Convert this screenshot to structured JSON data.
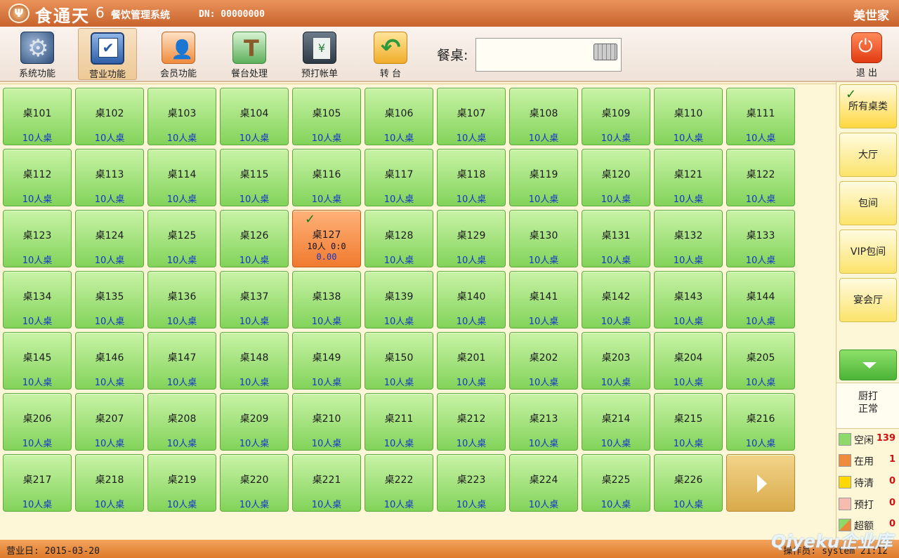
{
  "title_bar": {
    "brand": "食通天",
    "version": "6",
    "system_name": "餐饮管理系统",
    "dn": "DN: 00000000",
    "vendor": "美世家"
  },
  "toolbar": {
    "buttons": [
      {
        "label": "系统功能",
        "icon": "gear-icon"
      },
      {
        "label": "营业功能",
        "icon": "checkbox-icon",
        "active": true
      },
      {
        "label": "会员功能",
        "icon": "member-icon"
      },
      {
        "label": "餐台处理",
        "icon": "dining-table-icon"
      },
      {
        "label": "预打帐单",
        "icon": "bill-icon"
      },
      {
        "label": "转 台",
        "icon": "transfer-icon"
      }
    ],
    "table_label": "餐桌:",
    "table_input_value": "",
    "exit_label": "退 出"
  },
  "tables": [
    {
      "name": "桌101",
      "sub": "10人桌"
    },
    {
      "name": "桌102",
      "sub": "10人桌"
    },
    {
      "name": "桌103",
      "sub": "10人桌"
    },
    {
      "name": "桌104",
      "sub": "10人桌"
    },
    {
      "name": "桌105",
      "sub": "10人桌"
    },
    {
      "name": "桌106",
      "sub": "10人桌"
    },
    {
      "name": "桌107",
      "sub": "10人桌"
    },
    {
      "name": "桌108",
      "sub": "10人桌"
    },
    {
      "name": "桌109",
      "sub": "10人桌"
    },
    {
      "name": "桌110",
      "sub": "10人桌"
    },
    {
      "name": "桌111",
      "sub": "10人桌"
    },
    {
      "name": "桌112",
      "sub": "10人桌"
    },
    {
      "name": "桌113",
      "sub": "10人桌"
    },
    {
      "name": "桌114",
      "sub": "10人桌"
    },
    {
      "name": "桌115",
      "sub": "10人桌"
    },
    {
      "name": "桌116",
      "sub": "10人桌"
    },
    {
      "name": "桌117",
      "sub": "10人桌"
    },
    {
      "name": "桌118",
      "sub": "10人桌"
    },
    {
      "name": "桌119",
      "sub": "10人桌"
    },
    {
      "name": "桌120",
      "sub": "10人桌"
    },
    {
      "name": "桌121",
      "sub": "10人桌"
    },
    {
      "name": "桌122",
      "sub": "10人桌"
    },
    {
      "name": "桌123",
      "sub": "10人桌"
    },
    {
      "name": "桌124",
      "sub": "10人桌"
    },
    {
      "name": "桌125",
      "sub": "10人桌"
    },
    {
      "name": "桌126",
      "sub": "10人桌"
    },
    {
      "name": "桌127",
      "busy": true,
      "line": "10人 0:0",
      "amount": "0.00"
    },
    {
      "name": "桌128",
      "sub": "10人桌"
    },
    {
      "name": "桌129",
      "sub": "10人桌"
    },
    {
      "name": "桌130",
      "sub": "10人桌"
    },
    {
      "name": "桌131",
      "sub": "10人桌"
    },
    {
      "name": "桌132",
      "sub": "10人桌"
    },
    {
      "name": "桌133",
      "sub": "10人桌"
    },
    {
      "name": "桌134",
      "sub": "10人桌"
    },
    {
      "name": "桌135",
      "sub": "10人桌"
    },
    {
      "name": "桌136",
      "sub": "10人桌"
    },
    {
      "name": "桌137",
      "sub": "10人桌"
    },
    {
      "name": "桌138",
      "sub": "10人桌"
    },
    {
      "name": "桌139",
      "sub": "10人桌"
    },
    {
      "name": "桌140",
      "sub": "10人桌"
    },
    {
      "name": "桌141",
      "sub": "10人桌"
    },
    {
      "name": "桌142",
      "sub": "10人桌"
    },
    {
      "name": "桌143",
      "sub": "10人桌"
    },
    {
      "name": "桌144",
      "sub": "10人桌"
    },
    {
      "name": "桌145",
      "sub": "10人桌"
    },
    {
      "name": "桌146",
      "sub": "10人桌"
    },
    {
      "name": "桌147",
      "sub": "10人桌"
    },
    {
      "name": "桌148",
      "sub": "10人桌"
    },
    {
      "name": "桌149",
      "sub": "10人桌"
    },
    {
      "name": "桌150",
      "sub": "10人桌"
    },
    {
      "name": "桌201",
      "sub": "10人桌"
    },
    {
      "name": "桌202",
      "sub": "10人桌"
    },
    {
      "name": "桌203",
      "sub": "10人桌"
    },
    {
      "name": "桌204",
      "sub": "10人桌"
    },
    {
      "name": "桌205",
      "sub": "10人桌"
    },
    {
      "name": "桌206",
      "sub": "10人桌"
    },
    {
      "name": "桌207",
      "sub": "10人桌"
    },
    {
      "name": "桌208",
      "sub": "10人桌"
    },
    {
      "name": "桌209",
      "sub": "10人桌"
    },
    {
      "name": "桌210",
      "sub": "10人桌"
    },
    {
      "name": "桌211",
      "sub": "10人桌"
    },
    {
      "name": "桌212",
      "sub": "10人桌"
    },
    {
      "name": "桌213",
      "sub": "10人桌"
    },
    {
      "name": "桌214",
      "sub": "10人桌"
    },
    {
      "name": "桌215",
      "sub": "10人桌"
    },
    {
      "name": "桌216",
      "sub": "10人桌"
    },
    {
      "name": "桌217",
      "sub": "10人桌"
    },
    {
      "name": "桌218",
      "sub": "10人桌"
    },
    {
      "name": "桌219",
      "sub": "10人桌"
    },
    {
      "name": "桌220",
      "sub": "10人桌"
    },
    {
      "name": "桌221",
      "sub": "10人桌"
    },
    {
      "name": "桌222",
      "sub": "10人桌"
    },
    {
      "name": "桌223",
      "sub": "10人桌"
    },
    {
      "name": "桌224",
      "sub": "10人桌"
    },
    {
      "name": "桌225",
      "sub": "10人桌"
    },
    {
      "name": "桌226",
      "sub": "10人桌"
    }
  ],
  "categories": [
    {
      "label": "所有桌类",
      "selected": true
    },
    {
      "label": "大厅"
    },
    {
      "label": "包间"
    },
    {
      "label": "VIP包间"
    },
    {
      "label": "宴会厅"
    }
  ],
  "kitchen_status": {
    "line1": "厨打",
    "line2": "正常"
  },
  "legend": [
    {
      "label": "空闲",
      "count": "139",
      "color": "#8fd86a"
    },
    {
      "label": "在用",
      "count": "1",
      "color": "#f08a3c"
    },
    {
      "label": "待清",
      "count": "0",
      "color": "#ffd800"
    },
    {
      "label": "预打",
      "count": "0",
      "color": "#f6bcb0"
    },
    {
      "label": "超额",
      "count": "0",
      "color": "#e98a3a"
    }
  ],
  "status_bar": {
    "business_date": "营业日: 2015-03-20",
    "operator": "操作员: system   21:12"
  },
  "watermark": "Qiyeku企业库"
}
